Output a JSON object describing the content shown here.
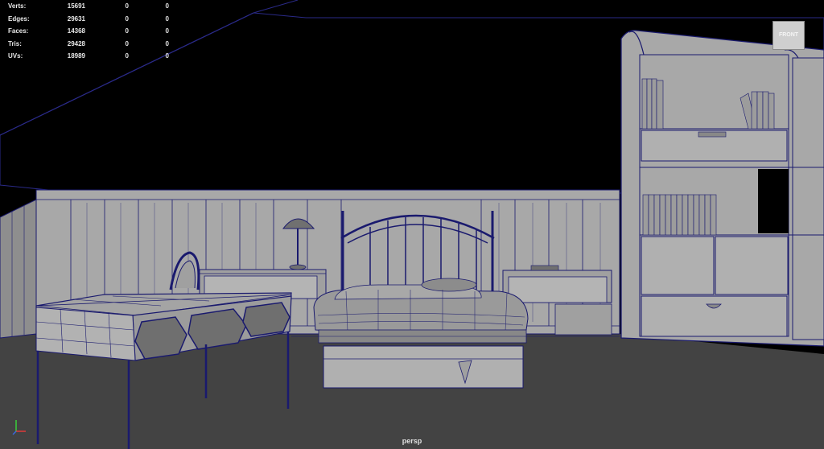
{
  "hud": {
    "rows": [
      {
        "label": "Verts:",
        "total": "15691",
        "selected": "0",
        "component": "0"
      },
      {
        "label": "Edges:",
        "total": "29631",
        "selected": "0",
        "component": "0"
      },
      {
        "label": "Faces:",
        "total": "14368",
        "selected": "0",
        "component": "0"
      },
      {
        "label": "Tris:",
        "total": "29428",
        "selected": "0",
        "component": "0"
      },
      {
        "label": "UVs:",
        "total": "18989",
        "selected": "0",
        "component": "0"
      }
    ]
  },
  "viewport": {
    "camera_name": "persp",
    "view_cube_label": "FRONT"
  },
  "colors": {
    "background": "#000000",
    "wall": "#a6a6a6",
    "floor": "#404040",
    "wireframe": "#1a1a6e"
  },
  "icons": {
    "view_cube": "view-cube-icon",
    "axis_gizmo": "axis-gizmo-icon"
  }
}
